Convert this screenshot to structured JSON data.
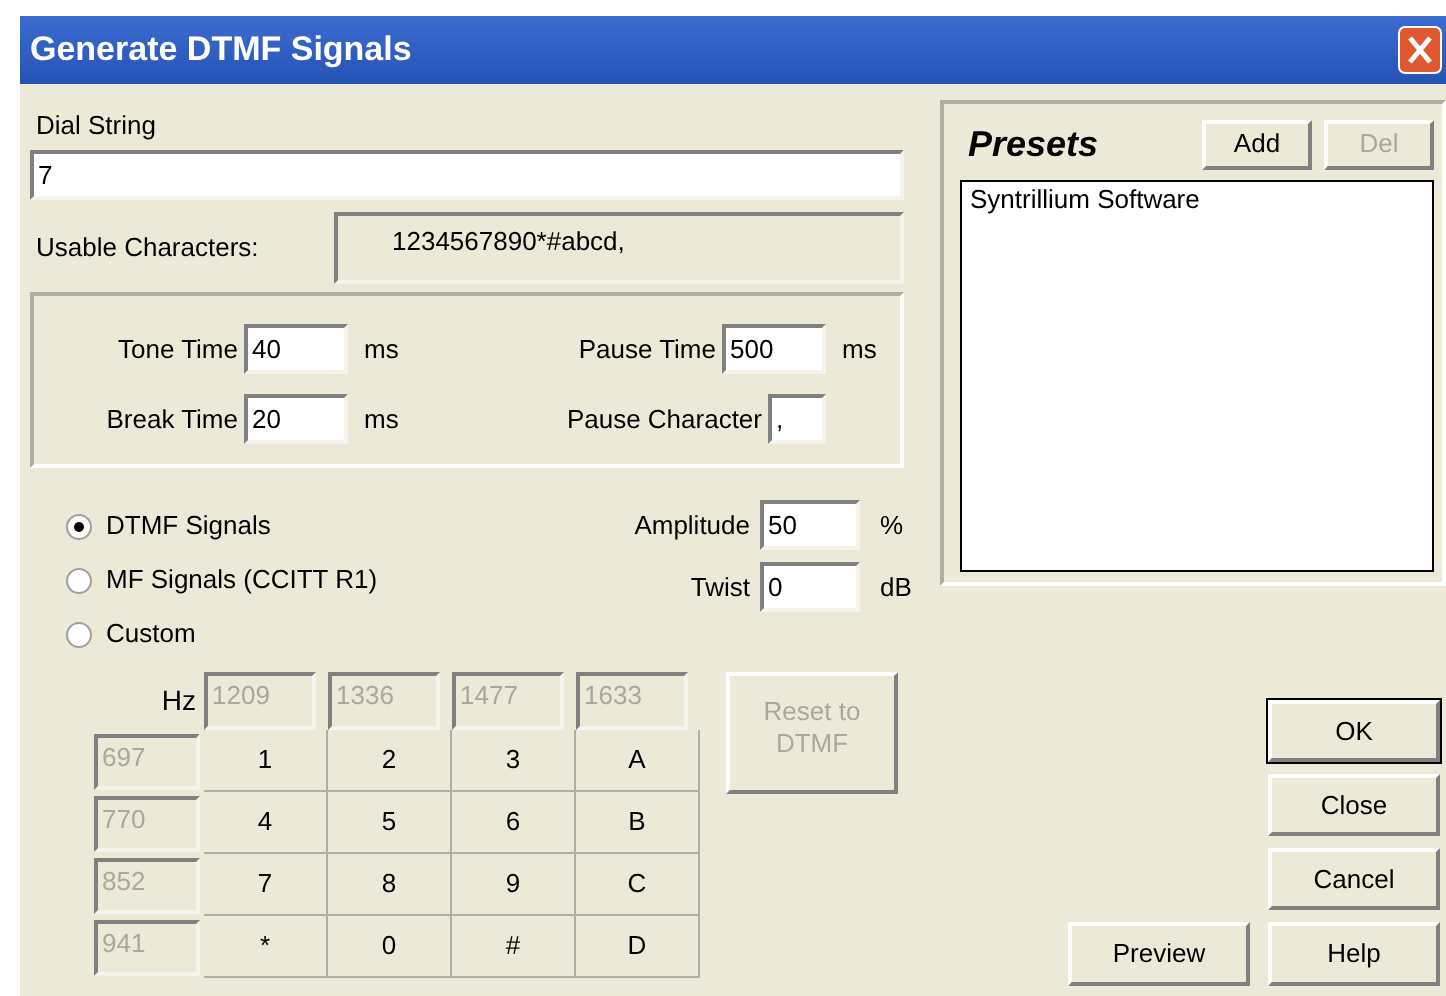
{
  "window": {
    "title": "Generate DTMF Signals"
  },
  "dial_string": {
    "label": "Dial String",
    "value": "7"
  },
  "usable_characters": {
    "label": "Usable Characters:",
    "value": "1234567890*#abcd,"
  },
  "timing": [
    {
      "label": "Tone Time",
      "value": "40",
      "unit": "ms"
    },
    {
      "label": "Pause Time",
      "value": "500",
      "unit": "ms"
    },
    {
      "label": "Break Time",
      "value": "20",
      "unit": "ms"
    },
    {
      "label": "Pause Character",
      "value": ","
    }
  ],
  "signal_types": [
    {
      "label": "DTMF Signals",
      "selected": true
    },
    {
      "label": "MF Signals (CCITT R1)",
      "selected": false
    },
    {
      "label": "Custom",
      "selected": false
    }
  ],
  "levels": [
    {
      "label": "Amplitude",
      "value": "50",
      "unit": "%"
    },
    {
      "label": "Twist",
      "value": "0",
      "unit": "dB"
    }
  ],
  "keypad": {
    "hz_label": "Hz",
    "frequencies_disabled": true,
    "column_frequencies": [
      "1209",
      "1336",
      "1477",
      "1633"
    ],
    "rows": [
      {
        "frequency": "697",
        "keys": [
          "1",
          "2",
          "3",
          "A"
        ]
      },
      {
        "frequency": "770",
        "keys": [
          "4",
          "5",
          "6",
          "B"
        ]
      },
      {
        "frequency": "852",
        "keys": [
          "7",
          "8",
          "9",
          "C"
        ]
      },
      {
        "frequency": "941",
        "keys": [
          "*",
          "0",
          "#",
          "D"
        ]
      }
    ]
  },
  "reset_button": {
    "label": "Reset to DTMF",
    "disabled": true
  },
  "presets": {
    "title": "Presets",
    "buttons": [
      {
        "label": "Add",
        "disabled": false
      },
      {
        "label": "Del",
        "disabled": true
      }
    ],
    "items": [
      {
        "label": "Syntrillium Software",
        "selected": false
      }
    ]
  },
  "buttons": [
    {
      "label": "OK",
      "default": true
    },
    {
      "label": "Close",
      "default": false
    },
    {
      "label": "Cancel",
      "default": false
    }
  ],
  "bottom_buttons": [
    {
      "label": "Preview"
    },
    {
      "label": "Help"
    }
  ]
}
